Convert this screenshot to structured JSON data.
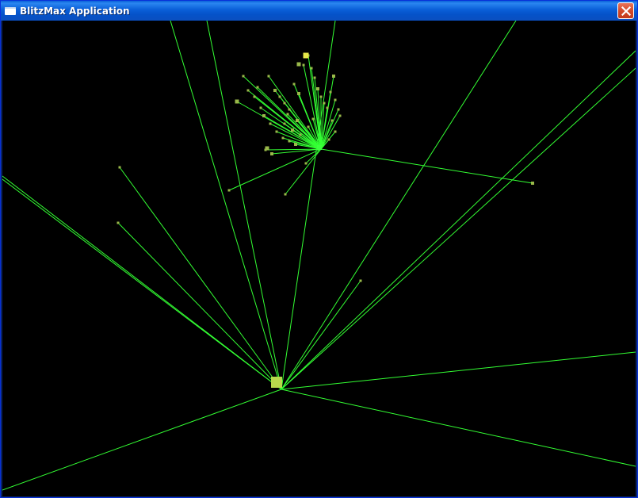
{
  "window": {
    "title": "BlitzMax Application",
    "app_icon": "window-icon",
    "close_icon": "close-icon"
  },
  "canvas": {
    "background": "#000000",
    "line_color": "#33ff33",
    "particle_color": "#9ab84a",
    "hub_color": "#b8d84c"
  }
}
